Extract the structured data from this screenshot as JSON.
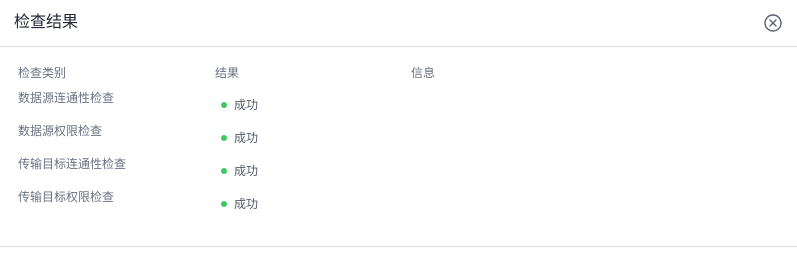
{
  "dialog": {
    "title": "检查结果",
    "close_icon": "close-circle-icon"
  },
  "table": {
    "columns": [
      "检查类别",
      "结果",
      "信息"
    ],
    "rows": [
      {
        "category": "数据源连通性检查",
        "result": "成功",
        "info": ""
      },
      {
        "category": "数据源权限检查",
        "result": "成功",
        "info": ""
      },
      {
        "category": "传输目标连通性检查",
        "result": "成功",
        "info": ""
      },
      {
        "category": "传输目标权限检查",
        "result": "成功",
        "info": ""
      }
    ]
  },
  "colors": {
    "success_dot": "#3ec85f",
    "divider": "#d9dbe3"
  }
}
